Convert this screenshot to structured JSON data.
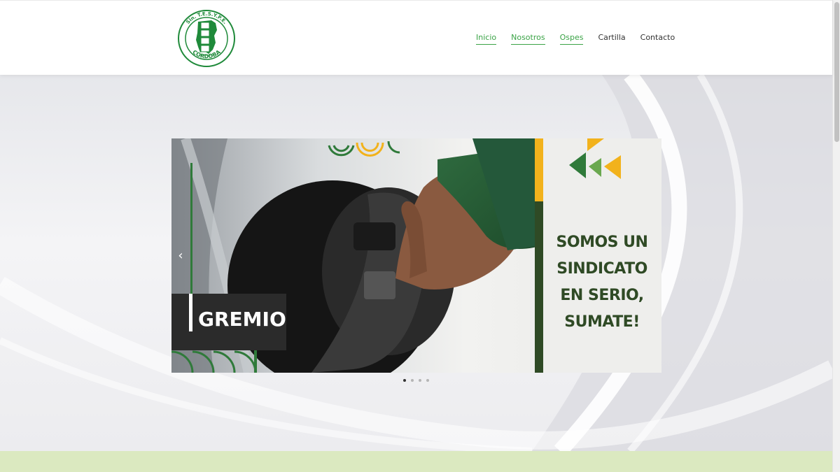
{
  "header": {
    "logo": {
      "top_text": "Sin. T.E.S.Y.P.E.",
      "bottom_text": "CORDOBA",
      "small_text": "CORDOBA",
      "colors": {
        "green": "#1f8a3a",
        "white": "#ffffff"
      }
    },
    "nav": [
      {
        "label": "Inicio",
        "active": true
      },
      {
        "label": "Nosotros",
        "active": true
      },
      {
        "label": "Ospes",
        "active": true
      },
      {
        "label": "Cartilla",
        "active": false
      },
      {
        "label": "Contacto",
        "active": false
      }
    ]
  },
  "slider": {
    "badge": "GREMIO",
    "slogan": [
      "SOMOS UN",
      "SINDICATO",
      "EN SERIO,",
      "SUMATE!"
    ],
    "prev_icon": "chevron-left-icon",
    "dots": [
      {
        "active": true
      },
      {
        "active": false
      },
      {
        "active": false
      },
      {
        "active": false
      }
    ]
  },
  "colors": {
    "accent_green": "#3aa346",
    "dark_green": "#2f4a25",
    "brand_yellow": "#f2b21c",
    "strip_green": "#dbe9c0"
  }
}
